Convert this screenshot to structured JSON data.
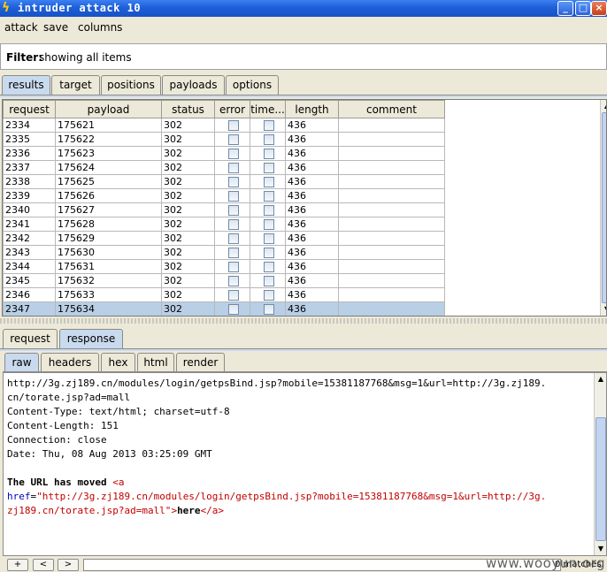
{
  "window": {
    "title": "intruder attack 10",
    "min": "_",
    "max": "□",
    "close": "×"
  },
  "menu": [
    "attack",
    "save",
    "columns"
  ],
  "filter": {
    "label": "Filter:",
    "value": "showing all items"
  },
  "main_tabs": [
    "results",
    "target",
    "positions",
    "payloads",
    "options"
  ],
  "results": {
    "columns": [
      "request",
      "payload",
      "status",
      "error",
      "time...",
      "length",
      "comment"
    ],
    "rows": [
      {
        "request": "2334",
        "payload": "175621",
        "status": "302",
        "length": "436"
      },
      {
        "request": "2335",
        "payload": "175622",
        "status": "302",
        "length": "436"
      },
      {
        "request": "2336",
        "payload": "175623",
        "status": "302",
        "length": "436"
      },
      {
        "request": "2337",
        "payload": "175624",
        "status": "302",
        "length": "436"
      },
      {
        "request": "2338",
        "payload": "175625",
        "status": "302",
        "length": "436"
      },
      {
        "request": "2339",
        "payload": "175626",
        "status": "302",
        "length": "436"
      },
      {
        "request": "2340",
        "payload": "175627",
        "status": "302",
        "length": "436"
      },
      {
        "request": "2341",
        "payload": "175628",
        "status": "302",
        "length": "436"
      },
      {
        "request": "2342",
        "payload": "175629",
        "status": "302",
        "length": "436"
      },
      {
        "request": "2343",
        "payload": "175630",
        "status": "302",
        "length": "436"
      },
      {
        "request": "2344",
        "payload": "175631",
        "status": "302",
        "length": "436"
      },
      {
        "request": "2345",
        "payload": "175632",
        "status": "302",
        "length": "436"
      },
      {
        "request": "2346",
        "payload": "175633",
        "status": "302",
        "length": "436"
      },
      {
        "request": "2347",
        "payload": "175634",
        "status": "302",
        "length": "436"
      }
    ],
    "selected_request": "2347"
  },
  "rr_tabs": [
    "request",
    "response"
  ],
  "view_tabs": [
    "raw",
    "headers",
    "hex",
    "html",
    "render"
  ],
  "response": {
    "header_lines": [
      "http://3g.zj189.cn/modules/login/getpsBind.jsp?mobile=15381187768&msg=1&url=http://3g.zj189.",
      "cn/torate.jsp?ad=mall",
      "Content-Type: text/html; charset=utf-8",
      "Content-Length: 151",
      "Connection: close",
      "Date: Thu, 08 Aug 2013 03:25:09 GMT"
    ],
    "body_text": "The URL has moved ",
    "body_tag_open": "<a",
    "href_attr": "href",
    "href_value": "\"http://3g.zj189.cn/modules/login/getpsBind.jsp?mobile=15381187768&msg=1&url=http://3g.",
    "href_value_cont": "zj189.cn/torate.jsp?ad=mall\"",
    "link_text": "here",
    "tag_close": "</a>"
  },
  "bottom": {
    "buttons": [
      "+",
      "<",
      ">"
    ],
    "matches": "0 matches"
  },
  "watermark": "www.wooyun.org"
}
